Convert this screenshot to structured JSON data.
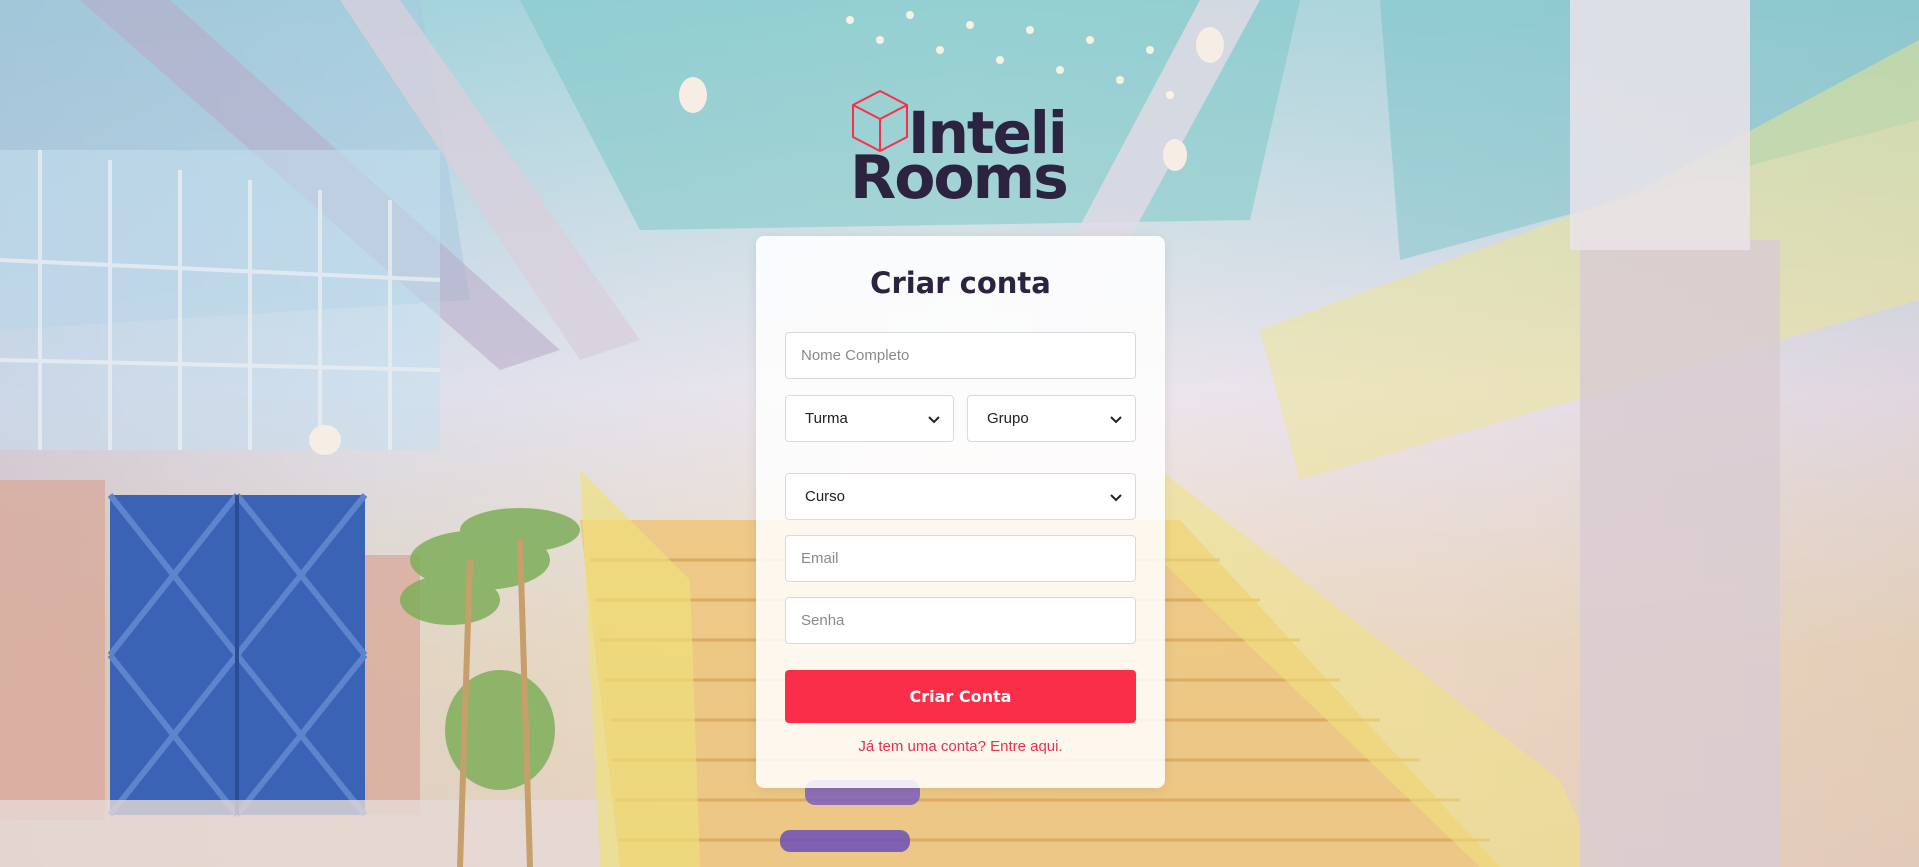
{
  "brand": {
    "line1": "Inteli",
    "line2": "Rooms",
    "accent_color": "#fb2e4a",
    "text_color": "#2b2340"
  },
  "form": {
    "title": "Criar conta",
    "name_placeholder": "Nome Completo",
    "turma_label": "Turma",
    "grupo_label": "Grupo",
    "curso_label": "Curso",
    "email_placeholder": "Email",
    "senha_placeholder": "Senha",
    "submit_label": "Criar Conta",
    "login_link": "Já tem uma conta? Entre aqui."
  }
}
